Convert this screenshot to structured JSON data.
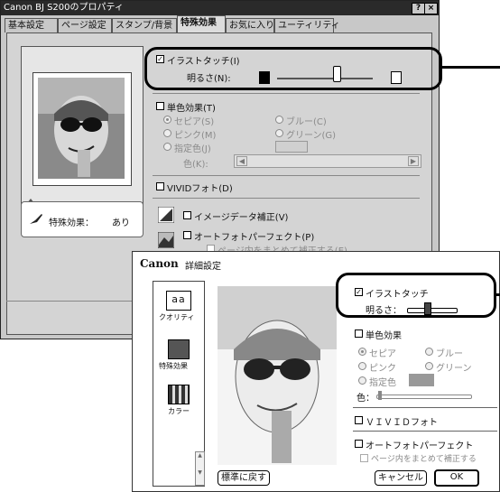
{
  "main_window": {
    "title": "Canon BJ S200のプロパティ",
    "help_btn": "?",
    "close_btn": "×",
    "tabs": [
      "基本設定",
      "ページ設定",
      "スタンプ/背景",
      "特殊効果",
      "お気に入り",
      "ユーティリティ"
    ],
    "active_tab": 3,
    "preview_caption_label": "特殊効果：",
    "preview_caption_value": "あり",
    "illustration_label": "イラストタッチ(I)",
    "brightness_label": "明るさ(N):",
    "mono_label": "単色効果(T)",
    "radios": [
      {
        "label": "セピア(S)",
        "selected": true
      },
      {
        "label": "ブルー(C)",
        "selected": false
      },
      {
        "label": "ピンク(M)",
        "selected": false
      },
      {
        "label": "グリーン(G)",
        "selected": false
      },
      {
        "label": "指定色(J)",
        "selected": false
      }
    ],
    "color_label": "色(K):",
    "vivid_label": "VIVIDフォト(D)",
    "image_data_label": "イメージデータ補正(V)",
    "autophoto_label": "オートフォトパーフェクト(P)",
    "page_batch_label": "ページ内をまとめて補正する(E)",
    "illustration_checked": true,
    "brightness_level": 0.62
  },
  "detail_dialog": {
    "brand": "Canon",
    "title": "詳細設定",
    "nav": [
      "クオリティ",
      "特殊効果",
      "カラー"
    ],
    "illustration_label": "イラストタッチ",
    "brightness_label": "明るさ：",
    "mono_label": "単色効果",
    "radios": [
      {
        "label": "セピア",
        "selected": true
      },
      {
        "label": "ブルー",
        "selected": false
      },
      {
        "label": "ピンク",
        "selected": false
      },
      {
        "label": "グリーン",
        "selected": false
      },
      {
        "label": "指定色",
        "selected": false
      }
    ],
    "color_label": "色：",
    "vivid_label": "ＶＩＶＩＤフォト",
    "autophoto_label": "オートフォトパーフェクト",
    "page_batch_label": "ページ内をまとめて補正する",
    "reset_button": "標準に戻す",
    "cancel_button": "キャンセル",
    "ok_button": "OK",
    "illustration_checked": true,
    "brightness_level": 0.4
  },
  "colors": {
    "window_bg": "#c8c8c8",
    "titlebar": "#2a2a2a",
    "highlight": "#000000"
  }
}
